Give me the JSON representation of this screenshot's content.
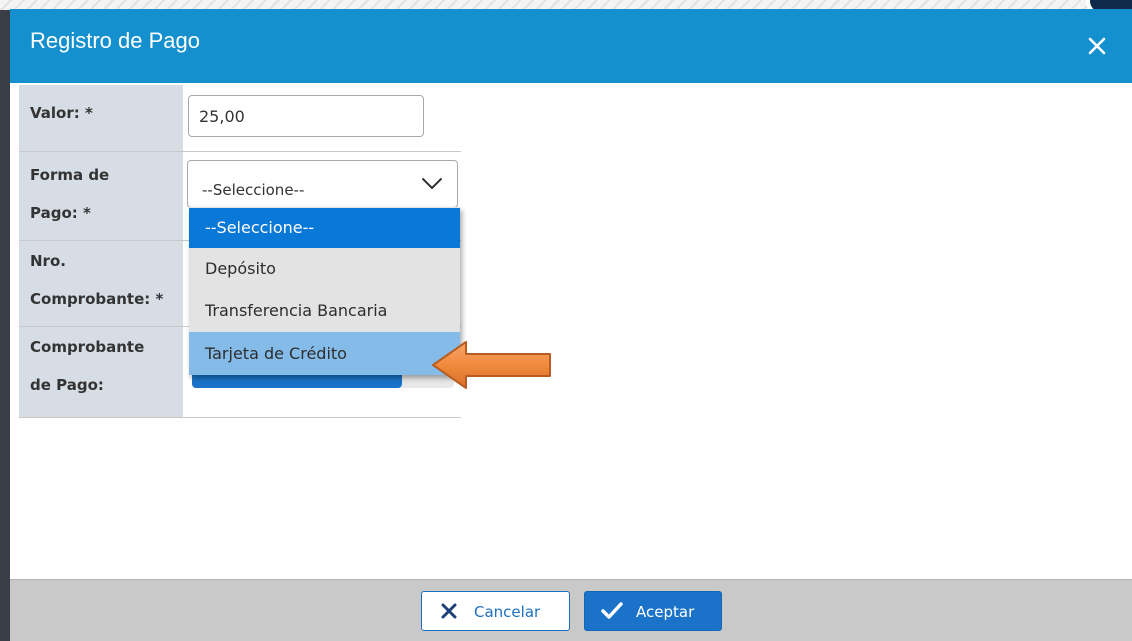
{
  "modal": {
    "title": "Registro de Pago",
    "close_icon": "close-icon"
  },
  "form": {
    "valor": {
      "label": "Valor: *",
      "value": "25,00"
    },
    "forma_pago": {
      "label_line1": "Forma de",
      "label_line2": "Pago: *",
      "selected": "--Seleccione--",
      "options": [
        "--Seleccione--",
        "Depósito",
        "Transferencia Bancaria",
        "Tarjeta de Crédito"
      ],
      "highlighted_option": "Tarjeta de Crédito"
    },
    "nro_comprobante": {
      "label_line1": "Nro.",
      "label_line2": "Comprobante: *"
    },
    "comprobante_pago": {
      "label_line1": "Comprobante",
      "label_line2": "de Pago:"
    }
  },
  "footer": {
    "cancel_label": "Cancelar",
    "accept_label": "Aceptar"
  },
  "colors": {
    "header": "#1590cf",
    "option_selected": "#0a78d7",
    "option_hover": "#84bbe8",
    "annotation_arrow": "#f08a3c"
  }
}
